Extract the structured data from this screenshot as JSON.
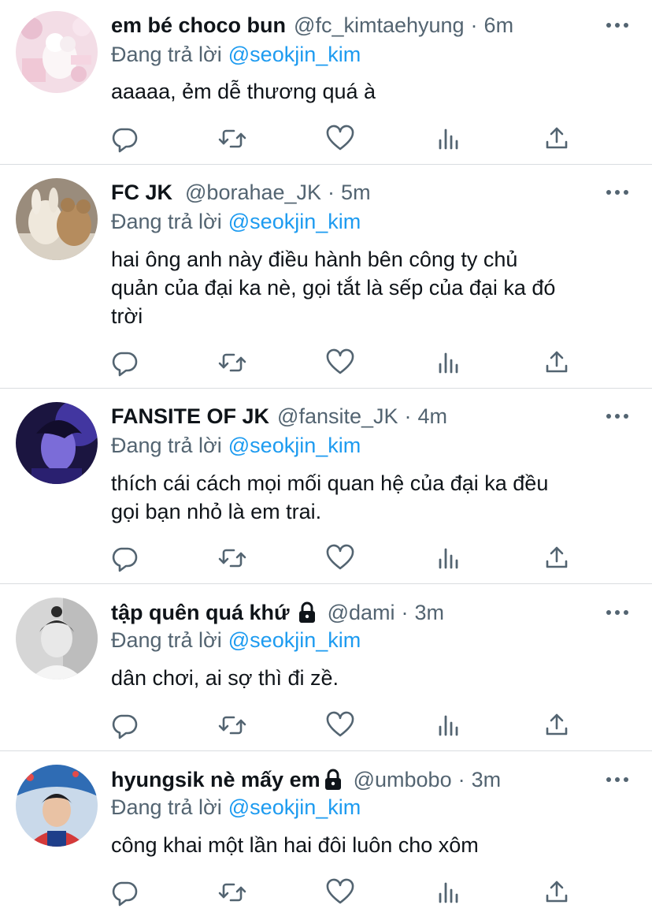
{
  "reply_prefix": "Đang trả lời",
  "tweets": [
    {
      "display_name": "em bé choco bun",
      "handle": "@fc_kimtaehyung",
      "time": "6m",
      "reply_to": "@seokjin_kim",
      "lines": [
        "aaaaa, ẻm dễ thương quá à"
      ],
      "locked": false
    },
    {
      "display_name": "FC JK",
      "handle": "@borahae_JK",
      "time": "5m",
      "reply_to": "@seokjin_kim",
      "lines": [
        "hai ông anh này điều hành bên công ty chủ",
        "quản của đại ka nè, gọi tắt là sếp của đại ka đó",
        "trời"
      ],
      "locked": false
    },
    {
      "display_name": "FANSITE OF JK",
      "handle": "@fansite_JK",
      "time": "4m",
      "reply_to": "@seokjin_kim",
      "lines": [
        "thích cái cách mọi mối quan hệ của đại ka đều",
        "gọi bạn nhỏ là em trai."
      ],
      "locked": false
    },
    {
      "display_name": "tập quên quá khứ",
      "handle": "@dami",
      "time": "3m",
      "reply_to": "@seokjin_kim",
      "lines": [
        "dân chơi, ai sợ thì đi zề."
      ],
      "locked": true
    },
    {
      "display_name": "hyungsik nè mấy em",
      "handle": "@umbobo",
      "time": "3m",
      "reply_to": "@seokjin_kim",
      "lines": [
        "công khai một lần hai đôi luôn cho xôm"
      ],
      "locked": true
    }
  ],
  "icons": {
    "reply": "reply-icon",
    "retweet": "retweet-icon",
    "like": "heart-icon",
    "analytics": "analytics-icon",
    "share": "share-icon",
    "more": "more-icon",
    "lock": "lock-icon"
  },
  "colors": {
    "text": "#0f1419",
    "secondary": "#536471",
    "mention": "#1d9bf0",
    "divider": "#d9dde0"
  }
}
